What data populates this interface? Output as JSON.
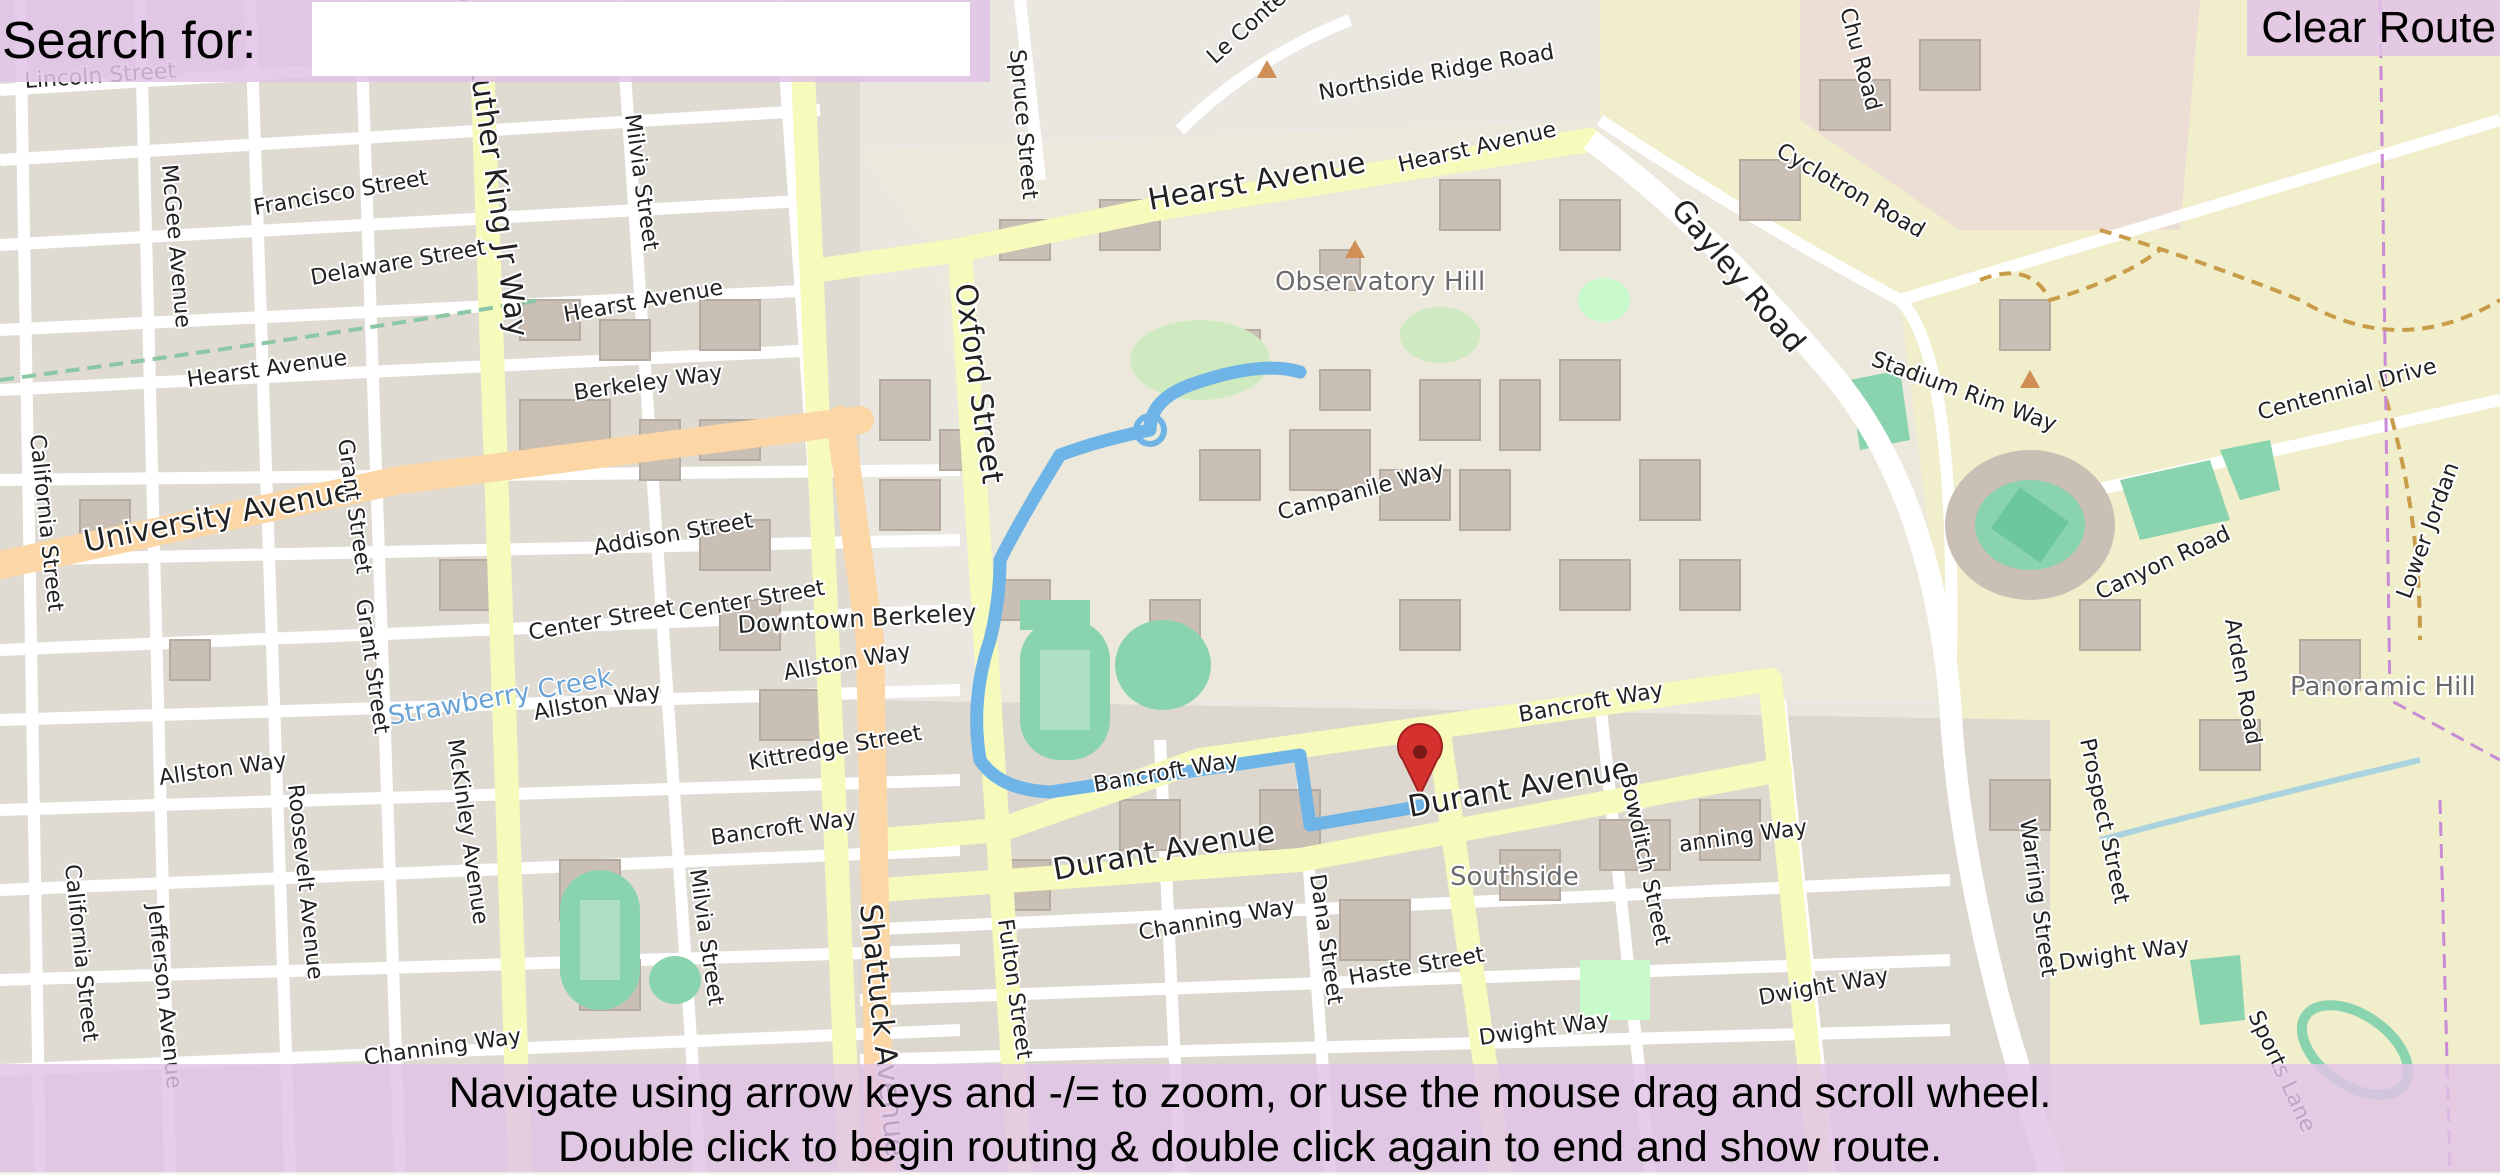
{
  "search": {
    "label": "Search for:",
    "value": "",
    "placeholder": ""
  },
  "controls": {
    "clear_route": "Clear Route"
  },
  "instructions": {
    "line1": "Navigate using arrow keys and -/= to zoom, or use the mouse drag and scroll wheel.",
    "line2": "Double click to begin routing & double click again to end and show route."
  },
  "map": {
    "streets": {
      "hearst_1": "Hearst Avenue",
      "hearst_2": "Hearst Avenue",
      "hearst_3": "Hearst Avenue",
      "hearst_4": "Hearst Avenue",
      "university": "University Avenue",
      "bancroft_1": "Bancroft Way",
      "bancroft_2": "Bancroft Way",
      "bancroft_3": "Bancroft Way",
      "durant_1": "Durant Avenue",
      "durant_2": "Durant Avenue",
      "oxford": "Oxford Street",
      "shattuck": "Shattuck Avenue",
      "mlk": "Martin Luther King Jr Way",
      "milvia_1": "Milvia Street",
      "milvia_2": "Milvia Street",
      "francisco": "Francisco Street",
      "delaware": "Delaware Street",
      "berkeley_way": "Berkeley Way",
      "addison": "Addison Street",
      "center_1": "Center Street",
      "center_2": "Center Street",
      "allston_1": "Allston Way",
      "allston_2": "Allston Way",
      "allston_3": "Allston Way",
      "kittredge": "Kittredge Street",
      "channing_1": "Channing Way",
      "channing_2": "Channing Way",
      "channing_3": "anning Way",
      "haste": "Haste Street",
      "dwight_1": "Dwight Way",
      "dwight_2": "Dwight Way",
      "dwight_3": "Dwight Way",
      "dana": "Dana Street",
      "fulton": "Fulton Street",
      "bowditch": "Bowditch Street",
      "gayley": "Gayley Road",
      "cyclotron": "Cyclotron Road",
      "stadium_rim": "Stadium Rim Way",
      "centennial": "Centennial Drive",
      "canyon": "Canyon Road",
      "prospect": "Prospect Street",
      "warring": "Warring Street",
      "northside_ridge": "Northside Ridge Road",
      "le_conte": "Le Conte Avenue",
      "spruce": "Spruce Street",
      "campanile": "Campanile Way",
      "grant_1": "Grant Street",
      "grant_2": "Grant Street",
      "mcgee": "McGee Avenue",
      "mckinley": "McKinley Avenue",
      "roosevelt": "Roosevelt Avenue",
      "jefferson": "Jefferson Avenue",
      "california_1": "California Street",
      "california_2": "California Street",
      "lincoln": "Lincoln Street",
      "arden": "Arden Road",
      "lower_jordan": "Lower Jordan",
      "sports_lane": "Sports Lane",
      "chu": "Chu Road"
    },
    "places": {
      "observatory_hill": "Observatory Hill",
      "downtown_berkeley": "Downtown Berkeley",
      "southside": "Southside",
      "panoramic_hill": "Panoramic Hill",
      "strawberry_creek": "Strawberry Creek"
    },
    "colors": {
      "background": "#f2efe9",
      "campus": "#e8e6d8",
      "residential": "#dfdbd3",
      "building": "#c9bfb5",
      "primary_road": "#fcd6a4",
      "secondary_road": "#f6fabb",
      "minor_road": "#ffffff",
      "park": "#c8facc",
      "pitch": "#8ad3af",
      "hill_area": "#f1eecb",
      "route": "#6eb4e6",
      "marker": "#d5312e"
    }
  }
}
